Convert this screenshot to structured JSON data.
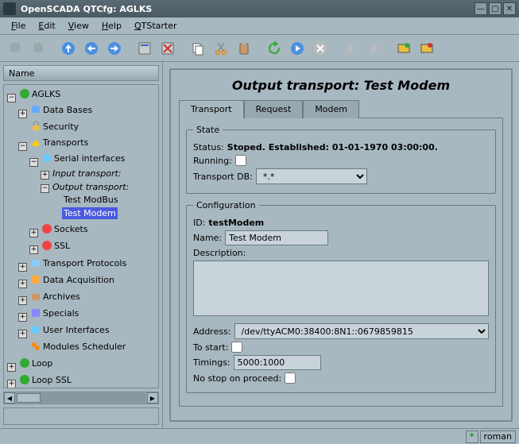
{
  "window": {
    "title": "OpenSCADA QTCfg: AGLKS"
  },
  "menu": {
    "file": "File",
    "edit": "Edit",
    "view": "View",
    "help": "Help",
    "qtstarter": "QTStarter"
  },
  "tree": {
    "header": "Name",
    "root": "AGLKS",
    "databases": "Data Bases",
    "security": "Security",
    "transports": "Transports",
    "serial": "Serial interfaces",
    "input_tr": "Input transport:",
    "output_tr": "Output transport:",
    "test_modbus": "Test ModBus",
    "test_modem": "Test Modem",
    "sockets": "Sockets",
    "ssl": "SSL",
    "tprotocols": "Transport Protocols",
    "dataacq": "Data Acquisition",
    "archives": "Archives",
    "specials": "Specials",
    "ui": "User Interfaces",
    "modsched": "Modules Scheduler",
    "loop": "Loop",
    "loopssl": "Loop SSL"
  },
  "page": {
    "title": "Output transport: Test Modem",
    "tabs": {
      "transport": "Transport",
      "request": "Request",
      "modem": "Modem"
    },
    "state": {
      "legend": "State",
      "status_label": "Status:",
      "status_value": "Stoped. Established: 01-01-1970 03:00:00.",
      "running_label": "Running:",
      "running": false,
      "tdb_label": "Transport DB:",
      "tdb_value": "*.*"
    },
    "config": {
      "legend": "Configuration",
      "id_label": "ID:",
      "id_value": "testModem",
      "name_label": "Name:",
      "name_value": "Test Modem",
      "desc_label": "Description:",
      "desc_value": "",
      "addr_label": "Address:",
      "addr_value": "/dev/ttyACM0:38400:8N1::0679859815",
      "tostart_label": "To start:",
      "tostart": false,
      "timings_label": "Timings:",
      "timings_value": "5000:1000",
      "nostop_label": "No stop on proceed:",
      "nostop": false
    }
  },
  "status": {
    "user": "roman",
    "indicator": "*"
  }
}
